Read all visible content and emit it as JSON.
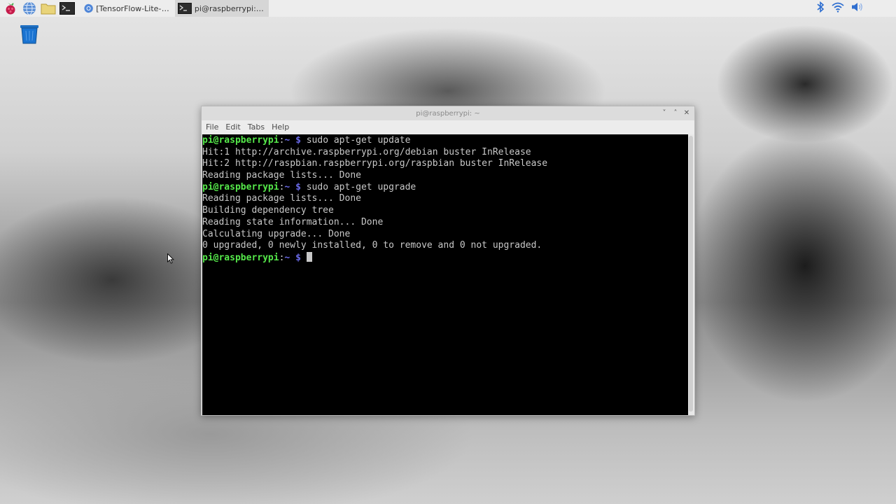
{
  "taskbar": {
    "tasks": [
      {
        "label": "[TensorFlow-Lite-Obje...",
        "icon": "chromium-icon"
      },
      {
        "label": "pi@raspberrypi: ~",
        "icon": "terminal-icon"
      }
    ]
  },
  "terminal": {
    "title": "pi@raspberrypi: ~",
    "menu": [
      "File",
      "Edit",
      "Tabs",
      "Help"
    ],
    "prompt": {
      "user_host": "pi@raspberrypi",
      "sep": ":",
      "path": "~",
      "dollar": "$"
    },
    "lines": [
      {
        "type": "cmd",
        "text": "sudo apt-get update"
      },
      {
        "type": "out",
        "text": "Hit:1 http://archive.raspberrypi.org/debian buster InRelease"
      },
      {
        "type": "out",
        "text": "Hit:2 http://raspbian.raspberrypi.org/raspbian buster InRelease"
      },
      {
        "type": "out",
        "text": "Reading package lists... Done"
      },
      {
        "type": "cmd",
        "text": "sudo apt-get upgrade"
      },
      {
        "type": "out",
        "text": "Reading package lists... Done"
      },
      {
        "type": "out",
        "text": "Building dependency tree"
      },
      {
        "type": "out",
        "text": "Reading state information... Done"
      },
      {
        "type": "out",
        "text": "Calculating upgrade... Done"
      },
      {
        "type": "out",
        "text": "0 upgraded, 0 newly installed, 0 to remove and 0 not upgraded."
      },
      {
        "type": "cmd",
        "text": "",
        "cursor": true
      }
    ]
  },
  "colors": {
    "prompt_user": "#55e84a",
    "prompt_path": "#6a6ae8",
    "terminal_bg": "#000000",
    "terminal_fg": "#c8c8c8"
  }
}
